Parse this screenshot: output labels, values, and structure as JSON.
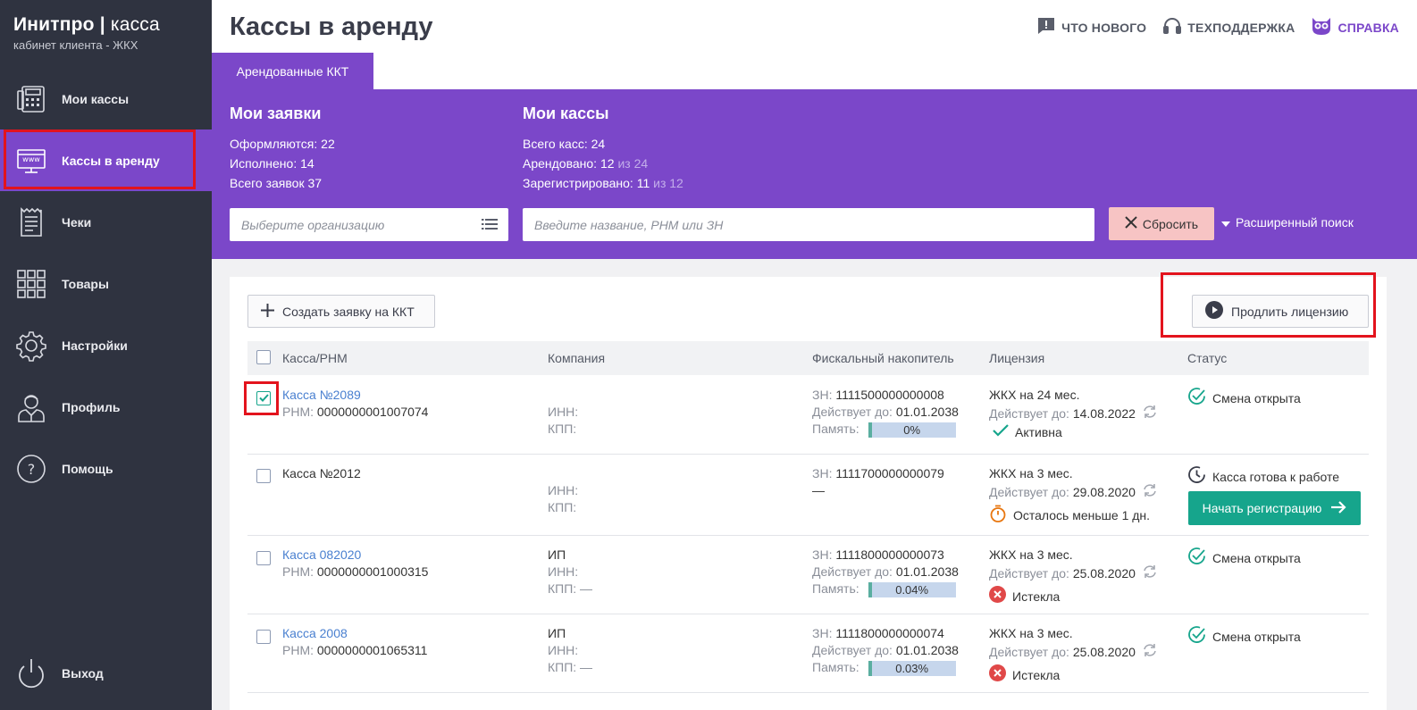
{
  "brand": {
    "name_bold": "Инитпро",
    "name_light": "касса",
    "subtitle": "кабинет клиента - ЖКХ"
  },
  "sidebar": {
    "items": [
      {
        "label": "Мои кассы",
        "icon": "cash-register-icon"
      },
      {
        "label": "Кассы в аренду",
        "icon": "www-monitor-icon",
        "active": true
      },
      {
        "label": "Чеки",
        "icon": "receipt-icon"
      },
      {
        "label": "Товары",
        "icon": "grid-icon"
      },
      {
        "label": "Настройки",
        "icon": "gear-icon"
      },
      {
        "label": "Профиль",
        "icon": "user-icon"
      },
      {
        "label": "Помощь",
        "icon": "help-icon"
      }
    ],
    "logout_label": "Выход"
  },
  "header": {
    "title": "Кассы в аренду",
    "links": [
      {
        "label": "ЧТО НОВОГО",
        "icon": "message-alert-icon"
      },
      {
        "label": "ТЕХПОДДЕРЖКА",
        "icon": "headset-icon"
      },
      {
        "label": "СПРАВКА",
        "icon": "owl-icon"
      }
    ]
  },
  "tabs": [
    {
      "label": "Арендованные ККТ"
    }
  ],
  "stats": {
    "requests": {
      "title": "Мои заявки",
      "lines": [
        {
          "label": "Оформляются:",
          "value": "22"
        },
        {
          "label": "Исполнено:",
          "value": "14"
        },
        {
          "label": "Всего заявок",
          "value": "37"
        }
      ]
    },
    "registers": {
      "title": "Мои кассы",
      "lines": [
        {
          "label": "Всего касс:",
          "value": "24",
          "extra": ""
        },
        {
          "label": "Арендовано:",
          "value": "12",
          "extra": "из 24"
        },
        {
          "label": "Зарегистрировано:",
          "value": "11",
          "extra": "из 12"
        }
      ]
    }
  },
  "filters": {
    "org_placeholder": "Выберите организацию",
    "search_placeholder": "Введите название, РНМ или ЗН",
    "reset_label": "Сбросить",
    "advanced_label": "Расширенный поиск"
  },
  "actions": {
    "create_label": "Создать заявку на ККТ",
    "extend_label": "Продлить лицензию"
  },
  "table": {
    "columns": [
      "Касса/РНМ",
      "Компания",
      "Фискальный накопитель",
      "Лицензия",
      "Статус"
    ],
    "rows": [
      {
        "name": "Касса №2089",
        "is_link": true,
        "rnm_label": "РНМ:",
        "rnm": "0000000001007074",
        "company": "",
        "inn": "ИНН:",
        "kpp": "КПП:",
        "zn_label": "ЗН:",
        "zn": "1111500000000008",
        "valid_label": "Действует до:",
        "valid": "01.01.2038",
        "mem_label": "Память:",
        "mem": "0%",
        "mem_fraction": 0.03,
        "license": "ЖКХ на 24 мес.",
        "lic_valid_label": "Действует до:",
        "lic_valid": "14.08.2022",
        "lic_state": "Активна",
        "lic_state_icon": "check-icon",
        "status": "Смена открыта",
        "status_icon": "check-circle-icon",
        "checked": true
      },
      {
        "name": "Касса №2012",
        "is_link": false,
        "rnm_label": "",
        "rnm": "",
        "company": "",
        "inn": "ИНН:",
        "kpp": "КПП:",
        "zn_label": "ЗН:",
        "zn": "1111700000000079",
        "valid_label": "",
        "valid": "—",
        "mem_label": "",
        "mem": "",
        "license": "ЖКХ на 3 мес.",
        "lic_valid_label": "Действует до:",
        "lic_valid": "29.08.2020",
        "lic_state": "Осталось меньше 1 дн.",
        "lic_state_icon": "stopwatch-icon",
        "status": "Касса готова к работе",
        "status_icon": "clock-icon",
        "action_label": "Начать регистрацию",
        "checked": false
      },
      {
        "name": "Касса 082020",
        "is_link": true,
        "rnm_label": "РНМ:",
        "rnm": "0000000001000315",
        "company": "ИП",
        "inn": "ИНН:",
        "kpp": "КПП: —",
        "zn_label": "ЗН:",
        "zn": "1111800000000073",
        "valid_label": "Действует до:",
        "valid": "01.01.2038",
        "mem_label": "Память:",
        "mem": "0.04%",
        "mem_fraction": 0.03,
        "license": "ЖКХ на 3 мес.",
        "lic_valid_label": "Действует до:",
        "lic_valid": "25.08.2020",
        "lic_state": "Истекла",
        "lic_state_icon": "error-icon",
        "status": "Смена открыта",
        "status_icon": "check-circle-icon",
        "checked": false
      },
      {
        "name": "Касса 2008",
        "is_link": true,
        "rnm_label": "РНМ:",
        "rnm": "0000000001065311",
        "company": "ИП",
        "inn": "ИНН:",
        "kpp": "КПП: —",
        "zn_label": "ЗН:",
        "zn": "1111800000000074",
        "valid_label": "Действует до:",
        "valid": "01.01.2038",
        "mem_label": "Память:",
        "mem": "0.03%",
        "mem_fraction": 0.03,
        "license": "ЖКХ на 3 мес.",
        "lic_valid_label": "Действует до:",
        "lic_valid": "25.08.2020",
        "lic_state": "Истекла",
        "lic_state_icon": "error-icon",
        "status": "Смена открыта",
        "status_icon": "check-circle-icon",
        "checked": false
      }
    ]
  },
  "colors": {
    "accent": "#7b47c9",
    "sidebar": "#2f3340",
    "link": "#4a80d0",
    "success": "#16a58c",
    "danger": "#e3131d"
  }
}
